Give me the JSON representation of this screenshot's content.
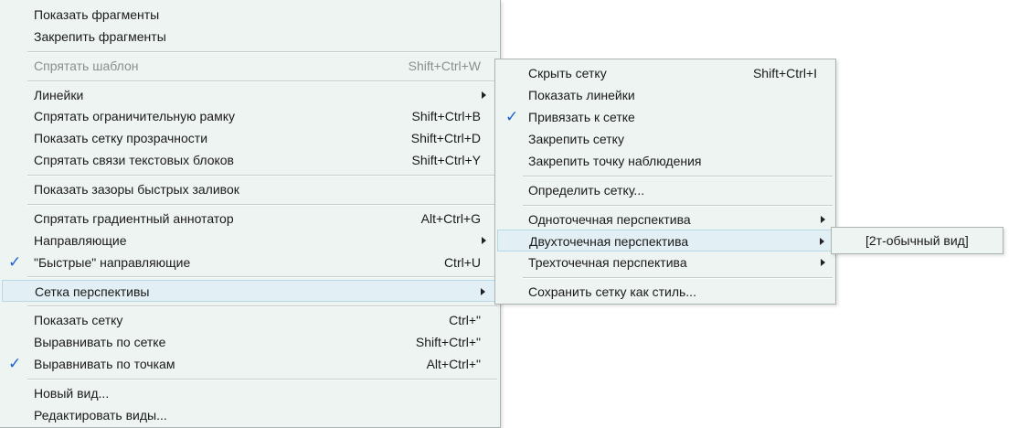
{
  "main_menu": {
    "show_fragments": "Показать фрагменты",
    "lock_fragments": "Закрепить фрагменты",
    "hide_template": "Спрятать шаблон",
    "hide_template_sc": "Shift+Ctrl+W",
    "rulers": "Линейки",
    "hide_bounding_box": "Спрятать ограничительную рамку",
    "hide_bounding_box_sc": "Shift+Ctrl+B",
    "show_transparency_grid": "Показать сетку прозрачности",
    "show_transparency_grid_sc": "Shift+Ctrl+D",
    "hide_text_threads": "Спрятать связи текстовых блоков",
    "hide_text_threads_sc": "Shift+Ctrl+Y",
    "show_live_paint_gaps": "Показать зазоры быстрых заливок",
    "hide_gradient_annotator": "Спрятать градиентный аннотатор",
    "hide_gradient_annotator_sc": "Alt+Ctrl+G",
    "guides": "Направляющие",
    "smart_guides": "\"Быстрые\" направляющие",
    "smart_guides_sc": "Ctrl+U",
    "perspective_grid": "Сетка перспективы",
    "show_grid": "Показать сетку",
    "show_grid_sc": "Ctrl+\"",
    "snap_to_grid": "Выравнивать по сетке",
    "snap_to_grid_sc": "Shift+Ctrl+\"",
    "snap_to_point": "Выравнивать по точкам",
    "snap_to_point_sc": "Alt+Ctrl+\"",
    "new_view": "Новый вид...",
    "edit_views": "Редактировать виды..."
  },
  "perspective_menu": {
    "hide_grid": "Скрыть сетку",
    "hide_grid_sc": "Shift+Ctrl+I",
    "show_rulers": "Показать линейки",
    "snap_to_grid": "Привязать к сетке",
    "lock_grid": "Закрепить сетку",
    "lock_station_point": "Закрепить точку наблюдения",
    "define_grid": "Определить сетку...",
    "one_point": "Одноточечная перспектива",
    "two_point": "Двухточечная перспектива",
    "three_point": "Трехточечная перспектива",
    "save_grid_preset": "Сохранить сетку как стиль..."
  },
  "two_point_menu": {
    "normal_view": "[2т-обычный вид]"
  },
  "icons": {
    "check": "✓"
  },
  "colors": {
    "menu_bg": "#eef4f2",
    "highlight": "#e2eff5",
    "check": "#1f5fd0"
  }
}
